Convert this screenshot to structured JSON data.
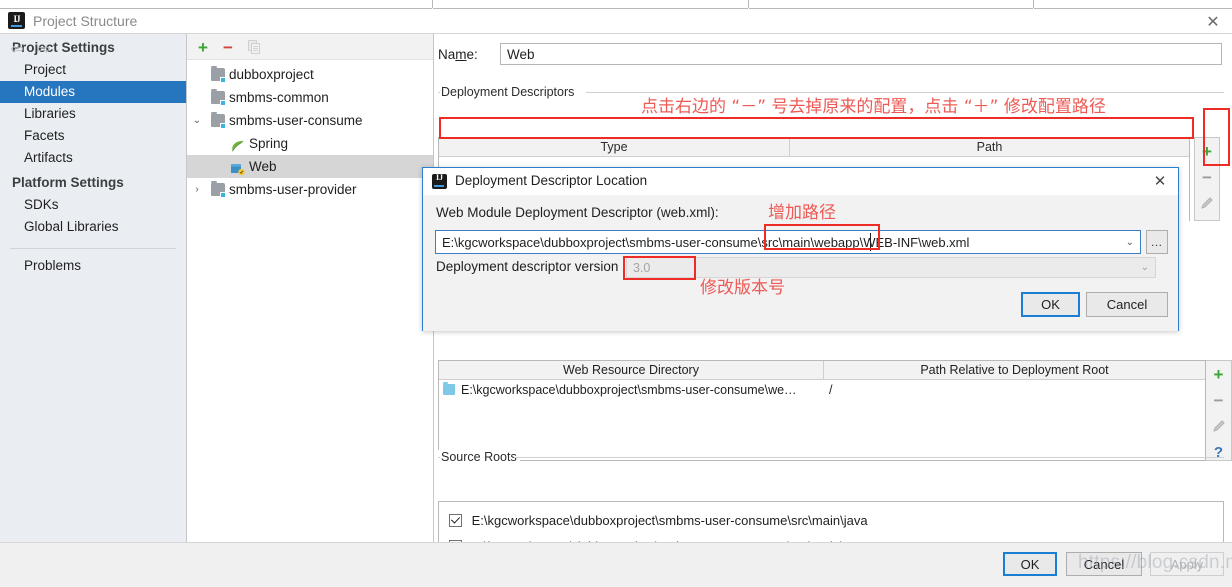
{
  "window": {
    "title": "Project Structure",
    "app_icon": "intellij-idea-icon",
    "close_label": "✕"
  },
  "sidebar": {
    "nav": {
      "back": "⇦",
      "forward": "⇨"
    },
    "groups": [
      {
        "label": "Project Settings",
        "items": [
          {
            "label": "Project",
            "selected": false
          },
          {
            "label": "Modules",
            "selected": true
          },
          {
            "label": "Libraries",
            "selected": false
          },
          {
            "label": "Facets",
            "selected": false
          },
          {
            "label": "Artifacts",
            "selected": false
          }
        ]
      },
      {
        "label": "Platform Settings",
        "items": [
          {
            "label": "SDKs",
            "selected": false
          },
          {
            "label": "Global Libraries",
            "selected": false
          }
        ]
      }
    ],
    "problems": "Problems",
    "help_label": "?"
  },
  "tree": {
    "toolbar": {
      "add": "+",
      "remove": "−",
      "copy": "copy-icon"
    },
    "nodes": [
      {
        "label": "dubboxproject",
        "indent": 0,
        "chevron": "",
        "icon": "module-folder-icon",
        "selected": false
      },
      {
        "label": "smbms-common",
        "indent": 0,
        "chevron": "",
        "icon": "module-folder-icon",
        "selected": false
      },
      {
        "label": "smbms-user-consume",
        "indent": 0,
        "chevron": "⌄",
        "icon": "module-folder-icon",
        "selected": false
      },
      {
        "label": "Spring",
        "indent": 1,
        "chevron": "",
        "icon": "spring-leaf-icon",
        "selected": false
      },
      {
        "label": "Web",
        "indent": 1,
        "chevron": "",
        "icon": "web-facet-icon",
        "selected": true
      },
      {
        "label": "smbms-user-provider",
        "indent": 0,
        "chevron": "›",
        "icon": "module-folder-icon",
        "selected": false
      }
    ]
  },
  "detail": {
    "name_label": "Name:",
    "name_value": "Web",
    "deployment_descriptors": {
      "group_label": "Deployment Descriptors",
      "columns": [
        "Type",
        "Path"
      ],
      "rows": [],
      "tools": {
        "add": "+",
        "remove": "−",
        "edit": "pencil-icon"
      }
    },
    "web_resource": {
      "columns": [
        "Web Resource Directory",
        "Path Relative to Deployment Root"
      ],
      "rows": [
        {
          "directory": "E:\\kgcworkspace\\dubboxproject\\smbms-user-consume\\we…",
          "path": "/"
        }
      ],
      "tools": {
        "add": "+",
        "remove": "−",
        "edit": "pencil-icon",
        "help": "?"
      }
    },
    "source_roots": {
      "group_label": "Source Roots",
      "items": [
        {
          "checked": true,
          "path": "E:\\kgcworkspace\\dubboxproject\\smbms-user-consume\\src\\main\\java"
        },
        {
          "checked": true,
          "path": "E:\\kgcworkspace\\dubboxproject\\smbms-user-consume\\src\\main\\resources"
        }
      ]
    }
  },
  "bottom_buttons": {
    "ok": "OK",
    "cancel": "Cancel",
    "apply": "Apply"
  },
  "dialog": {
    "title": "Deployment Descriptor Location",
    "close_label": "✕",
    "descriptor_label": "Web Module Deployment Descriptor (web.xml):",
    "descriptor_value": "E:\\kgcworkspace\\dubboxproject\\smbms-user-consume\\src\\main\\webapp\\WEB-INF\\web.xml",
    "browse_label": "…",
    "version_label": "Deployment descriptor version",
    "version_value": "3.0",
    "ok": "OK",
    "cancel": "Cancel",
    "caret": "⌄"
  },
  "annotations": {
    "descriptors_note": "点击右边的 “－” 号去掉原来的配置，点击 “＋” 修改配置路径",
    "add_path_note": "增加路径",
    "version_note": "修改版本号",
    "color": "#ee2b25"
  },
  "watermark": "https://blog.csdn.net/gaofengyan"
}
